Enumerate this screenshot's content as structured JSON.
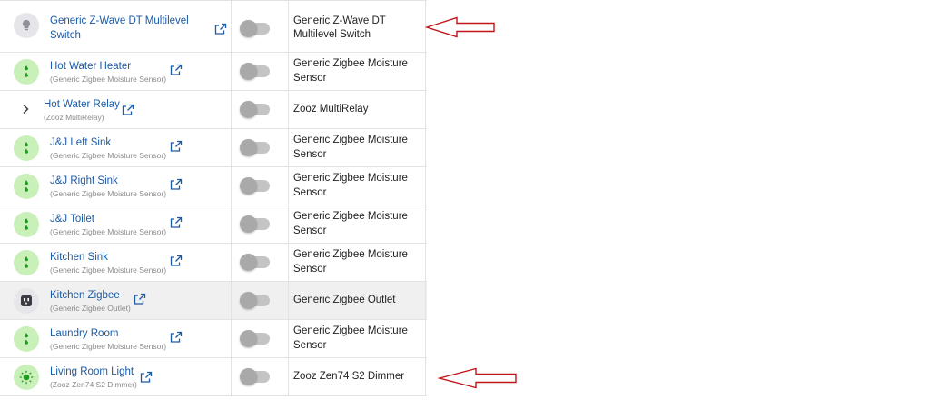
{
  "rows": [
    {
      "name": "Generic Z-Wave DT Multilevel Switch",
      "sub": "",
      "type": "Generic Z-Wave DT Multilevel Switch",
      "icon": "bulb-icon",
      "enabled": false
    },
    {
      "name": "Hot Water Heater",
      "sub": "(Generic Zigbee Moisture Sensor)",
      "type": "Generic Zigbee Moisture Sensor",
      "icon": "water-drops-icon",
      "enabled": false
    },
    {
      "name": "Hot Water Relay",
      "sub": "(Zooz MultiRelay)",
      "type": "Zooz MultiRelay",
      "icon": "chevron-right-icon",
      "enabled": false
    },
    {
      "name": "J&J Left Sink",
      "sub": "(Generic Zigbee Moisture Sensor)",
      "type": "Generic Zigbee Moisture Sensor",
      "icon": "water-drops-icon",
      "enabled": false
    },
    {
      "name": "J&J Right Sink",
      "sub": "(Generic Zigbee Moisture Sensor)",
      "type": "Generic Zigbee Moisture Sensor",
      "icon": "water-drops-icon",
      "enabled": false
    },
    {
      "name": "J&J Toilet",
      "sub": "(Generic Zigbee Moisture Sensor)",
      "type": "Generic Zigbee Moisture Sensor",
      "icon": "water-drops-icon",
      "enabled": false
    },
    {
      "name": "Kitchen Sink",
      "sub": "(Generic Zigbee Moisture Sensor)",
      "type": "Generic Zigbee Moisture Sensor",
      "icon": "water-drops-icon",
      "enabled": false
    },
    {
      "name": "Kitchen Zigbee",
      "sub": "(Generic Zigbee Outlet)",
      "type": "Generic Zigbee Outlet",
      "icon": "outlet-icon",
      "enabled": false
    },
    {
      "name": "Laundry Room",
      "sub": "(Generic Zigbee Moisture Sensor)",
      "type": "Generic Zigbee Moisture Sensor",
      "icon": "water-drops-icon",
      "enabled": false
    },
    {
      "name": "Living Room Light",
      "sub": "(Zooz Zen74 S2 Dimmer)",
      "type": "Zooz Zen74 S2 Dimmer",
      "icon": "light-on-icon",
      "enabled": false
    }
  ],
  "colors": {
    "link": "#1a5aa6",
    "arrow": "#c0161b",
    "avatar_green": "#c9f0b8",
    "icon_green": "#1f9a1f"
  }
}
